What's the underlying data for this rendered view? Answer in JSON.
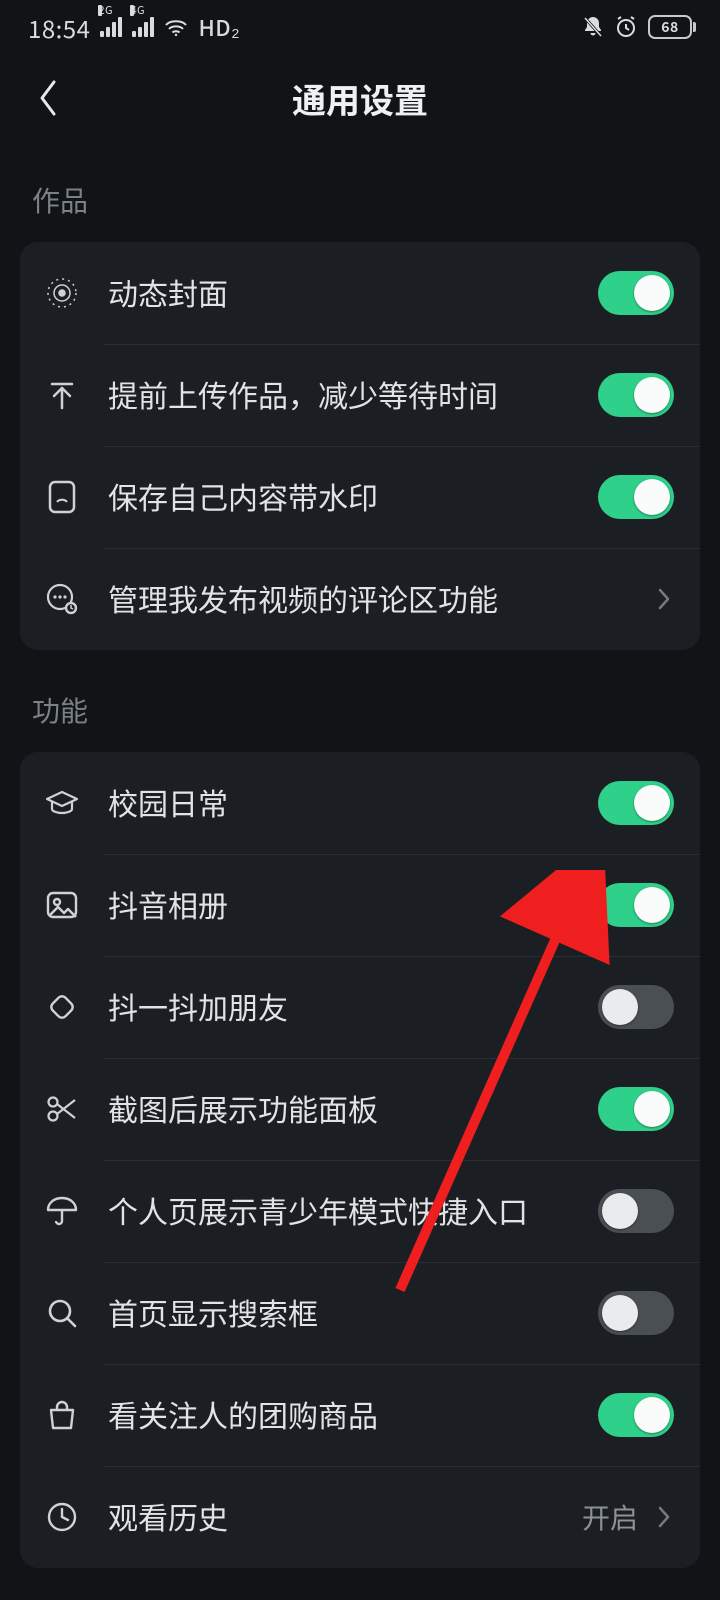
{
  "statusbar": {
    "time": "18:54",
    "net1_label": "2G",
    "net2_label": "4G",
    "hd": "HD₂",
    "battery_pct": "68"
  },
  "header": {
    "title": "通用设置"
  },
  "sections": [
    {
      "title": "作品",
      "rows": [
        {
          "icon": "target-icon",
          "label": "动态封面",
          "toggle": true
        },
        {
          "icon": "upload-icon",
          "label": "提前上传作品，减少等待时间",
          "toggle": true
        },
        {
          "icon": "ipad-icon",
          "label": "保存自己内容带水印",
          "toggle": true
        },
        {
          "icon": "comment-icon",
          "label": "管理我发布视频的评论区功能",
          "nav": true
        }
      ]
    },
    {
      "title": "功能",
      "rows": [
        {
          "icon": "cap-icon",
          "label": "校园日常",
          "toggle": true
        },
        {
          "icon": "photo-icon",
          "label": "抖音相册",
          "toggle": true
        },
        {
          "icon": "shake-icon",
          "label": "抖一抖加朋友",
          "toggle": false
        },
        {
          "icon": "scissors-icon",
          "label": "截图后展示功能面板",
          "toggle": true
        },
        {
          "icon": "umbrella-icon",
          "label": "个人页展示青少年模式快捷入口",
          "toggle": false
        },
        {
          "icon": "search-icon",
          "label": "首页显示搜索框",
          "toggle": false
        },
        {
          "icon": "bag-icon",
          "label": "看关注人的团购商品",
          "toggle": true
        },
        {
          "icon": "clock-icon",
          "label": "观看历史",
          "nav": true,
          "value": "开启"
        }
      ]
    }
  ],
  "annotation": {
    "kind": "red-arrow"
  }
}
